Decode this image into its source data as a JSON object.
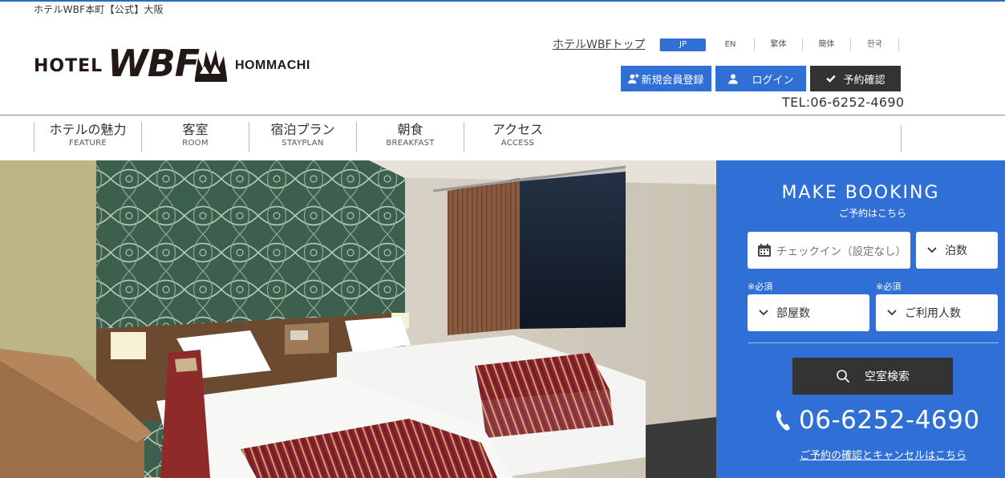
{
  "tagline": "ホテルWBF本町【公式】大阪",
  "logo": {
    "hotel": "HOTEL",
    "wbf": "WBF",
    "hommachi": "HOMMACHI"
  },
  "header": {
    "top_link": "ホテルWBFトップ",
    "languages": [
      {
        "label": "JP",
        "active": true
      },
      {
        "label": "EN",
        "active": false
      },
      {
        "label": "繁体",
        "active": false
      },
      {
        "label": "簡体",
        "active": false
      },
      {
        "label": "한국",
        "active": false
      }
    ],
    "register_label": "新規会員登録",
    "login_label": "ログイン",
    "reservation_label": "予約確認",
    "tel": "TEL:06-6252-4690"
  },
  "nav": [
    {
      "jp": "ホテルの魅力",
      "en": "FEATURE"
    },
    {
      "jp": "客室",
      "en": "ROOM"
    },
    {
      "jp": "宿泊プラン",
      "en": "STAYPLAN"
    },
    {
      "jp": "朝食",
      "en": "BREAKFAST"
    },
    {
      "jp": "アクセス",
      "en": "ACCESS"
    }
  ],
  "booking": {
    "title": "MAKE BOOKING",
    "subtitle": "ご予約はこちら",
    "checkin_placeholder": "チェックイン（設定なし）",
    "nights_label": "泊数",
    "required_label": "※必須",
    "rooms_label": "部屋数",
    "guests_label": "ご利用人数",
    "search_label": "空室検索",
    "phone": "06-6252-4690",
    "cancel_link": "ご予約の確認とキャンセルはこちら"
  },
  "colors": {
    "brand_blue": "#2f6fd6",
    "dark_button": "#333333",
    "accent_line": "#2a6db5"
  }
}
